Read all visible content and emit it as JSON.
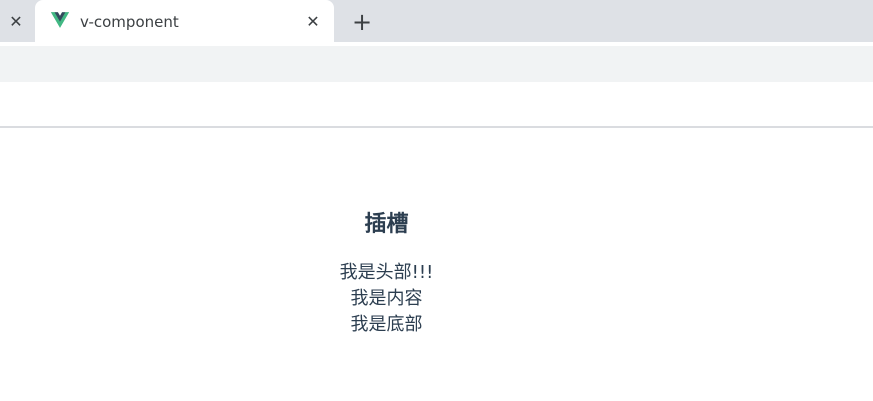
{
  "browser": {
    "tabs": [
      {
        "title": "v-component",
        "active": true
      }
    ],
    "icons": {
      "prev_tab_close": "close-icon",
      "tab_close": "close-icon",
      "new_tab": "plus-icon",
      "favicon": "vue-logo-icon"
    },
    "glyphs": {
      "close": "✕",
      "plus": "+"
    },
    "colors": {
      "vue_green": "#41b883",
      "vue_dark": "#35495e",
      "text": "#2c3e50"
    }
  },
  "page": {
    "heading": "插槽",
    "slot_header": "我是头部!!!",
    "slot_content": "我是内容",
    "slot_footer": "我是底部"
  }
}
